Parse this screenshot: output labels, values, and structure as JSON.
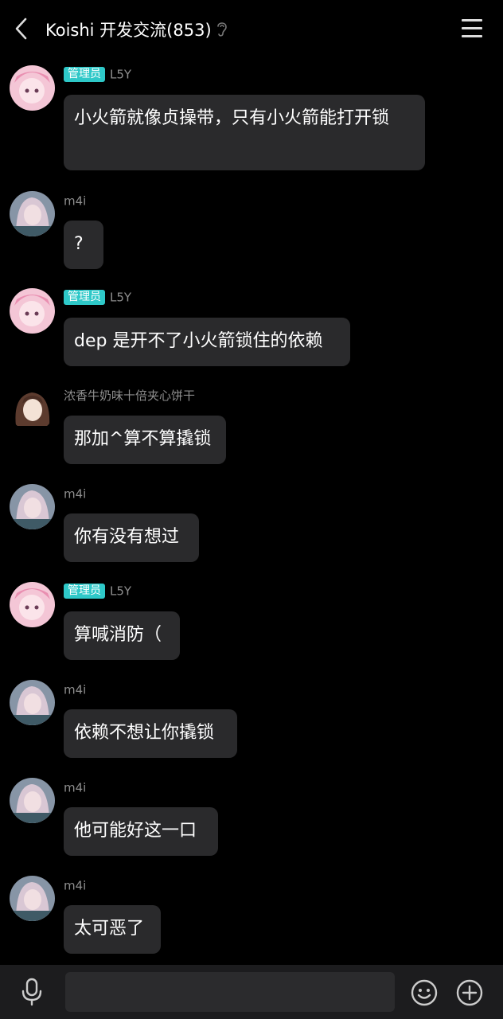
{
  "header": {
    "title": "Koishi 开发交流(853)",
    "back_icon": "chevron-left-icon",
    "ear_icon": "ear-icon",
    "menu_icon": "menu-icon"
  },
  "messages": [
    {
      "sender": "L5Y",
      "badge": "管理员",
      "avatar": "pink-anime-girl-avatar",
      "text": "小火箭就像贞操带，只有小火箭能打开锁"
    },
    {
      "sender": "m4i",
      "badge": "",
      "avatar": "silver-hair-anime-avatar",
      "text": "?"
    },
    {
      "sender": "L5Y",
      "badge": "管理员",
      "avatar": "pink-anime-girl-avatar",
      "text": "dep 是开不了小火箭锁住的依赖"
    },
    {
      "sender": "浓香牛奶味十倍夹心饼干",
      "badge": "",
      "avatar": "brown-hair-anime-avatar",
      "text": "那加^算不算撬锁"
    },
    {
      "sender": "m4i",
      "badge": "",
      "avatar": "silver-hair-anime-avatar",
      "text": "你有没有想过"
    },
    {
      "sender": "L5Y",
      "badge": "管理员",
      "avatar": "pink-anime-girl-avatar",
      "text": "算喊消防（"
    },
    {
      "sender": "m4i",
      "badge": "",
      "avatar": "silver-hair-anime-avatar",
      "text": "依赖不想让你撬锁"
    },
    {
      "sender": "m4i",
      "badge": "",
      "avatar": "silver-hair-anime-avatar",
      "text": "他可能好这一口"
    },
    {
      "sender": "m4i",
      "badge": "",
      "avatar": "silver-hair-anime-avatar",
      "text": "太可恶了"
    }
  ],
  "footer": {
    "mic_icon": "microphone-icon",
    "input_value": "",
    "emoji_icon": "emoji-icon",
    "plus_icon": "plus-icon"
  }
}
